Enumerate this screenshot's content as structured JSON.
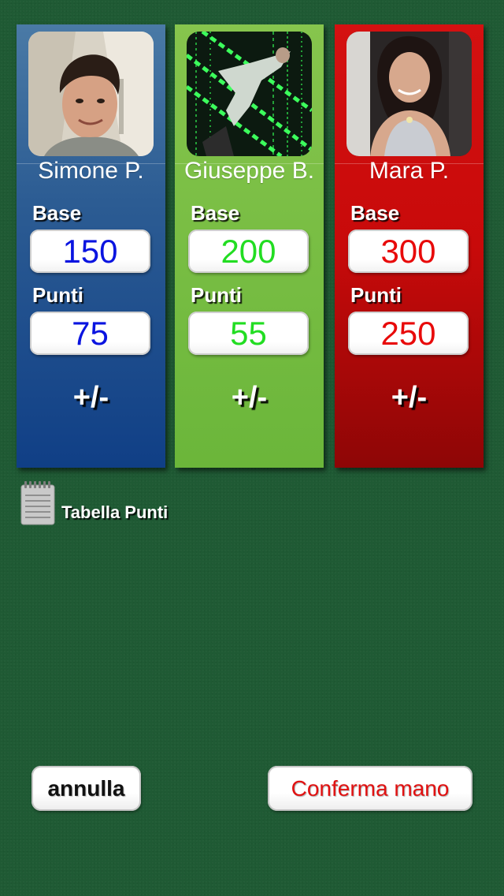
{
  "players": [
    {
      "name": "Simone P.",
      "base_label": "Base",
      "base_value": "150",
      "points_label": "Punti",
      "points_value": "75",
      "adjust_label": "+/-",
      "color": "#0a14e0"
    },
    {
      "name": "Giuseppe B.",
      "base_label": "Base",
      "base_value": "200",
      "points_label": "Punti",
      "points_value": "55",
      "adjust_label": "+/-",
      "color": "#22dd22"
    },
    {
      "name": "Mara P.",
      "base_label": "Base",
      "base_value": "300",
      "points_label": "Punti",
      "points_value": "250",
      "adjust_label": "+/-",
      "color": "#e80a0a"
    }
  ],
  "score_table": {
    "label": "Tabella Punti",
    "icon": "notepad-icon"
  },
  "buttons": {
    "cancel_label": "annulla",
    "confirm_label": "Conferma mano"
  },
  "colors": {
    "background": "#1f5a34",
    "card_blue": "#2c5c93",
    "card_green": "#6bb63a",
    "card_red": "#c80a0a",
    "confirm_text": "#e11111"
  }
}
